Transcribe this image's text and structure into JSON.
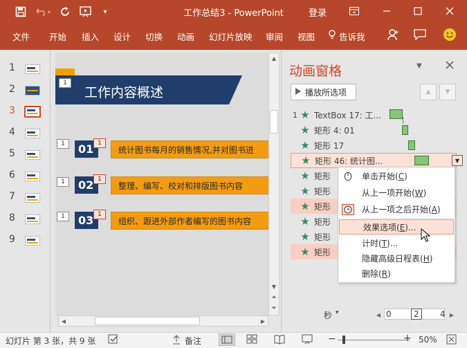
{
  "window": {
    "title": "工作总结3  -  PowerPoint",
    "login_label": "登录"
  },
  "ribbon": {
    "tabs": [
      "文件",
      "开始",
      "插入",
      "设计",
      "切换",
      "动画",
      "幻灯片放映",
      "审阅",
      "视图",
      "告诉我"
    ]
  },
  "thumbnails": {
    "numbers": [
      "1",
      "2",
      "3",
      "4",
      "5",
      "6",
      "7",
      "8",
      "9"
    ],
    "active_index": 2
  },
  "slide": {
    "title": "工作内容概述",
    "title_tag": "1",
    "items": [
      {
        "left_tag": "1",
        "num": "01",
        "tag": "1",
        "text": "统计图书每月的销售情况,并对图书进"
      },
      {
        "left_tag": "1",
        "num": "02",
        "tag": "1",
        "text": "整理、编写、校对和排版图书内容"
      },
      {
        "left_tag": "1",
        "num": "03",
        "tag": "1",
        "text": "组织、跟进外部作者编写的图书内容"
      }
    ]
  },
  "animation_pane": {
    "title": "动画窗格",
    "play_button": "播放所选项",
    "rows": [
      {
        "index": "1",
        "label": "TextBox 17: 工..."
      },
      {
        "index": "",
        "label": "矩形 4: 01"
      },
      {
        "index": "",
        "label": "矩形 17"
      },
      {
        "index": "",
        "label": "矩形 46: 统计图..."
      },
      {
        "index": "",
        "label": "矩形"
      },
      {
        "index": "",
        "label": "矩形"
      },
      {
        "index": "",
        "label": "矩形"
      },
      {
        "index": "",
        "label": "矩形"
      },
      {
        "index": "",
        "label": "矩形"
      },
      {
        "index": "",
        "label": "矩形"
      }
    ],
    "seconds_label": "秒",
    "scale": [
      "0",
      "2",
      "4"
    ]
  },
  "context_menu": {
    "items": [
      {
        "text": "单击开始",
        "key": "C"
      },
      {
        "text": "从上一项开始",
        "key": "W"
      },
      {
        "text": "从上一项之后开始",
        "key": "A"
      },
      {
        "text": "效果选项",
        "key": "E",
        "suffix": "..."
      },
      {
        "text": "计时",
        "key": "T",
        "suffix": "..."
      },
      {
        "text": "隐藏高级日程表",
        "key": "H"
      },
      {
        "text": "删除",
        "key": "R"
      }
    ]
  },
  "status": {
    "slide_info": "幻灯片 第 3 张，共 9 张",
    "notes_label": "备注",
    "zoom": "50%"
  },
  "colors": {
    "accent": "#b7472a",
    "title_red": "#d24726",
    "navy": "#213e6b",
    "orange": "#f39c12",
    "bar_green": "#88c47a",
    "star_green": "#3a8a5c"
  }
}
